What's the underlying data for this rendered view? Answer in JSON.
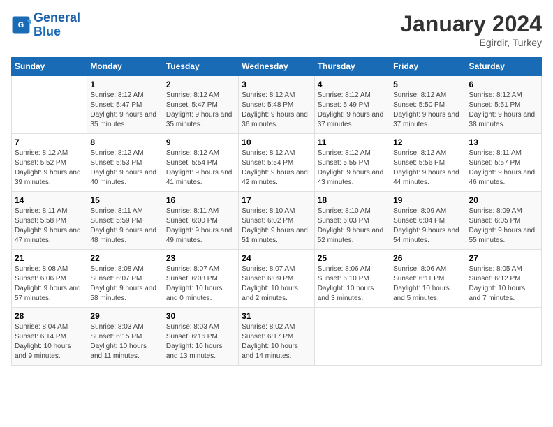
{
  "logo": {
    "text_general": "General",
    "text_blue": "Blue"
  },
  "header": {
    "title": "January 2024",
    "subtitle": "Egirdir, Turkey"
  },
  "days_of_week": [
    "Sunday",
    "Monday",
    "Tuesday",
    "Wednesday",
    "Thursday",
    "Friday",
    "Saturday"
  ],
  "weeks": [
    [
      {
        "day": "",
        "sunrise": "",
        "sunset": "",
        "daylight": ""
      },
      {
        "day": "1",
        "sunrise": "Sunrise: 8:12 AM",
        "sunset": "Sunset: 5:47 PM",
        "daylight": "Daylight: 9 hours and 35 minutes."
      },
      {
        "day": "2",
        "sunrise": "Sunrise: 8:12 AM",
        "sunset": "Sunset: 5:47 PM",
        "daylight": "Daylight: 9 hours and 35 minutes."
      },
      {
        "day": "3",
        "sunrise": "Sunrise: 8:12 AM",
        "sunset": "Sunset: 5:48 PM",
        "daylight": "Daylight: 9 hours and 36 minutes."
      },
      {
        "day": "4",
        "sunrise": "Sunrise: 8:12 AM",
        "sunset": "Sunset: 5:49 PM",
        "daylight": "Daylight: 9 hours and 37 minutes."
      },
      {
        "day": "5",
        "sunrise": "Sunrise: 8:12 AM",
        "sunset": "Sunset: 5:50 PM",
        "daylight": "Daylight: 9 hours and 37 minutes."
      },
      {
        "day": "6",
        "sunrise": "Sunrise: 8:12 AM",
        "sunset": "Sunset: 5:51 PM",
        "daylight": "Daylight: 9 hours and 38 minutes."
      }
    ],
    [
      {
        "day": "7",
        "sunrise": "Sunrise: 8:12 AM",
        "sunset": "Sunset: 5:52 PM",
        "daylight": "Daylight: 9 hours and 39 minutes."
      },
      {
        "day": "8",
        "sunrise": "Sunrise: 8:12 AM",
        "sunset": "Sunset: 5:53 PM",
        "daylight": "Daylight: 9 hours and 40 minutes."
      },
      {
        "day": "9",
        "sunrise": "Sunrise: 8:12 AM",
        "sunset": "Sunset: 5:54 PM",
        "daylight": "Daylight: 9 hours and 41 minutes."
      },
      {
        "day": "10",
        "sunrise": "Sunrise: 8:12 AM",
        "sunset": "Sunset: 5:54 PM",
        "daylight": "Daylight: 9 hours and 42 minutes."
      },
      {
        "day": "11",
        "sunrise": "Sunrise: 8:12 AM",
        "sunset": "Sunset: 5:55 PM",
        "daylight": "Daylight: 9 hours and 43 minutes."
      },
      {
        "day": "12",
        "sunrise": "Sunrise: 8:12 AM",
        "sunset": "Sunset: 5:56 PM",
        "daylight": "Daylight: 9 hours and 44 minutes."
      },
      {
        "day": "13",
        "sunrise": "Sunrise: 8:11 AM",
        "sunset": "Sunset: 5:57 PM",
        "daylight": "Daylight: 9 hours and 46 minutes."
      }
    ],
    [
      {
        "day": "14",
        "sunrise": "Sunrise: 8:11 AM",
        "sunset": "Sunset: 5:58 PM",
        "daylight": "Daylight: 9 hours and 47 minutes."
      },
      {
        "day": "15",
        "sunrise": "Sunrise: 8:11 AM",
        "sunset": "Sunset: 5:59 PM",
        "daylight": "Daylight: 9 hours and 48 minutes."
      },
      {
        "day": "16",
        "sunrise": "Sunrise: 8:11 AM",
        "sunset": "Sunset: 6:00 PM",
        "daylight": "Daylight: 9 hours and 49 minutes."
      },
      {
        "day": "17",
        "sunrise": "Sunrise: 8:10 AM",
        "sunset": "Sunset: 6:02 PM",
        "daylight": "Daylight: 9 hours and 51 minutes."
      },
      {
        "day": "18",
        "sunrise": "Sunrise: 8:10 AM",
        "sunset": "Sunset: 6:03 PM",
        "daylight": "Daylight: 9 hours and 52 minutes."
      },
      {
        "day": "19",
        "sunrise": "Sunrise: 8:09 AM",
        "sunset": "Sunset: 6:04 PM",
        "daylight": "Daylight: 9 hours and 54 minutes."
      },
      {
        "day": "20",
        "sunrise": "Sunrise: 8:09 AM",
        "sunset": "Sunset: 6:05 PM",
        "daylight": "Daylight: 9 hours and 55 minutes."
      }
    ],
    [
      {
        "day": "21",
        "sunrise": "Sunrise: 8:08 AM",
        "sunset": "Sunset: 6:06 PM",
        "daylight": "Daylight: 9 hours and 57 minutes."
      },
      {
        "day": "22",
        "sunrise": "Sunrise: 8:08 AM",
        "sunset": "Sunset: 6:07 PM",
        "daylight": "Daylight: 9 hours and 58 minutes."
      },
      {
        "day": "23",
        "sunrise": "Sunrise: 8:07 AM",
        "sunset": "Sunset: 6:08 PM",
        "daylight": "Daylight: 10 hours and 0 minutes."
      },
      {
        "day": "24",
        "sunrise": "Sunrise: 8:07 AM",
        "sunset": "Sunset: 6:09 PM",
        "daylight": "Daylight: 10 hours and 2 minutes."
      },
      {
        "day": "25",
        "sunrise": "Sunrise: 8:06 AM",
        "sunset": "Sunset: 6:10 PM",
        "daylight": "Daylight: 10 hours and 3 minutes."
      },
      {
        "day": "26",
        "sunrise": "Sunrise: 8:06 AM",
        "sunset": "Sunset: 6:11 PM",
        "daylight": "Daylight: 10 hours and 5 minutes."
      },
      {
        "day": "27",
        "sunrise": "Sunrise: 8:05 AM",
        "sunset": "Sunset: 6:12 PM",
        "daylight": "Daylight: 10 hours and 7 minutes."
      }
    ],
    [
      {
        "day": "28",
        "sunrise": "Sunrise: 8:04 AM",
        "sunset": "Sunset: 6:14 PM",
        "daylight": "Daylight: 10 hours and 9 minutes."
      },
      {
        "day": "29",
        "sunrise": "Sunrise: 8:03 AM",
        "sunset": "Sunset: 6:15 PM",
        "daylight": "Daylight: 10 hours and 11 minutes."
      },
      {
        "day": "30",
        "sunrise": "Sunrise: 8:03 AM",
        "sunset": "Sunset: 6:16 PM",
        "daylight": "Daylight: 10 hours and 13 minutes."
      },
      {
        "day": "31",
        "sunrise": "Sunrise: 8:02 AM",
        "sunset": "Sunset: 6:17 PM",
        "daylight": "Daylight: 10 hours and 14 minutes."
      },
      {
        "day": "",
        "sunrise": "",
        "sunset": "",
        "daylight": ""
      },
      {
        "day": "",
        "sunrise": "",
        "sunset": "",
        "daylight": ""
      },
      {
        "day": "",
        "sunrise": "",
        "sunset": "",
        "daylight": ""
      }
    ]
  ]
}
